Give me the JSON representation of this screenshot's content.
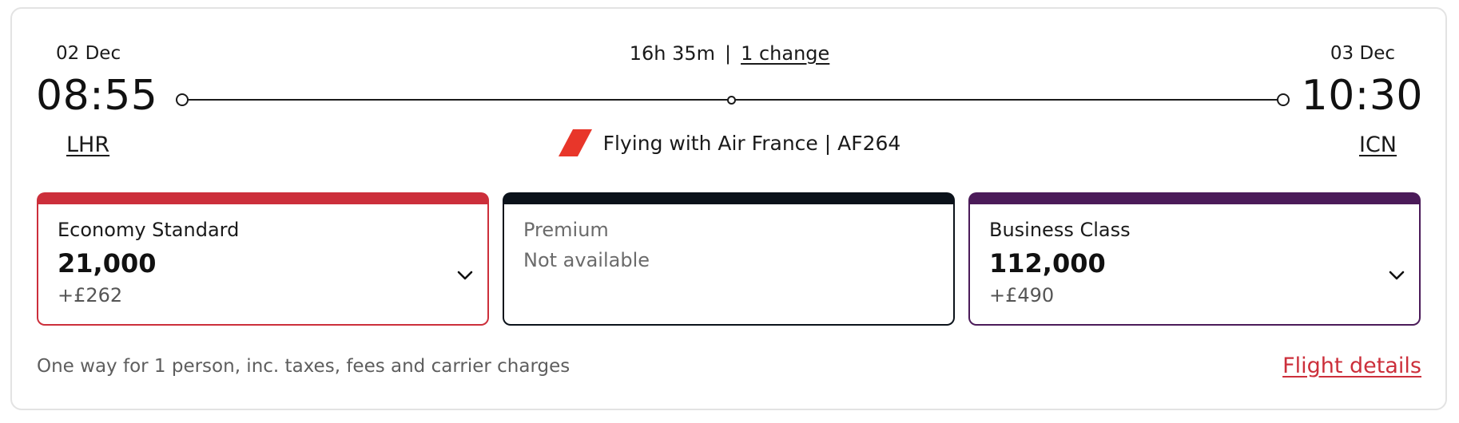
{
  "departure": {
    "date": "02 Dec",
    "time": "08:55",
    "airport": "LHR"
  },
  "arrival": {
    "date": "03 Dec",
    "time": "10:30",
    "airport": "ICN"
  },
  "journey": {
    "duration": "16h 35m",
    "separator": "|",
    "changes_label": "1 change"
  },
  "carrier": {
    "label": "Flying with Air France | AF264",
    "logo_icon": "air-france-logo-icon",
    "logo_color": "#e8362a"
  },
  "fares": [
    {
      "name": "Economy Standard",
      "points": "21,000",
      "cash": "+£262",
      "color": "#cc2f3b",
      "icon": "chevron-down-icon"
    },
    {
      "name": "Premium",
      "status": "Not available",
      "color": "#0b121a"
    },
    {
      "name": "Business Class",
      "points": "112,000",
      "cash": "+£490",
      "color": "#4b1b59",
      "icon": "chevron-down-icon"
    }
  ],
  "footer": {
    "note": "One way for 1 person, inc. taxes, fees and carrier charges",
    "details_link": "Flight details",
    "link_color": "#cc2f3b"
  }
}
